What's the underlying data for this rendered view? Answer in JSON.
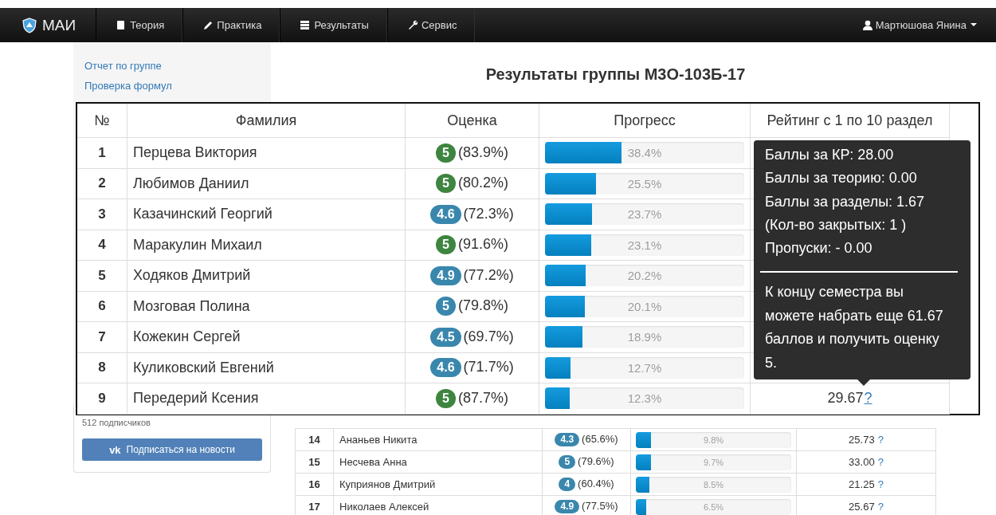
{
  "navbar": {
    "brand": "МАИ",
    "items": [
      {
        "label": "Теория",
        "kind": "book"
      },
      {
        "label": "Практика",
        "kind": "pencil"
      },
      {
        "label": "Результаты",
        "kind": "list"
      },
      {
        "label": "Сервис",
        "kind": "wrench"
      }
    ],
    "user": "Мартюшова Янина"
  },
  "sidebar": {
    "links": [
      "Отчет по группе",
      "Проверка формул"
    ],
    "subscribers": "512 подписчиков",
    "subscribe_button": {
      "logo": "vk",
      "label": "Подписаться на новости"
    }
  },
  "page_title": "Результаты группы М3О-103Б-17",
  "table": {
    "rows": [
      {
        "num": "14",
        "name": "Ананьев Никита",
        "grade": "4.3",
        "color": "#3a87ad",
        "percent": "(65.6%)",
        "level": 0.098,
        "progress": "9.8%",
        "rating": "25.73",
        "help": "?"
      },
      {
        "num": "15",
        "name": "Несчева Анна",
        "grade": "5",
        "color": "#3a87ad",
        "percent": "(79.6%)",
        "level": 0.097,
        "progress": "9.7%",
        "rating": "33.00",
        "help": "?"
      },
      {
        "num": "16",
        "name": "Куприянов Дмитрий",
        "grade": "4",
        "color": "#3a87ad",
        "percent": "(60.4%)",
        "level": 0.085,
        "progress": "8.5%",
        "rating": "21.25",
        "help": "?"
      },
      {
        "num": "17",
        "name": "Николаев Алексей",
        "grade": "4.9",
        "color": "#3a87ad",
        "percent": "(77.5%)",
        "level": 0.065,
        "progress": "6.5%",
        "rating": "25.67",
        "help": "?"
      }
    ]
  },
  "zoom_table": {
    "columns": [
      "№",
      "Фамилия",
      "Оценка",
      "Прогресс",
      "Рейтинг с 1 по 10 раздел"
    ],
    "rows": [
      {
        "num": "1",
        "name": "Перцева Виктория",
        "grade": "5",
        "color": "#3e8540",
        "percent": "(83.9%)",
        "level": 0.384,
        "progress": "38.4%"
      },
      {
        "num": "2",
        "name": "Любимов Даниил",
        "grade": "5",
        "color": "#3e8540",
        "percent": "(80.2%)",
        "level": 0.255,
        "progress": "25.5%"
      },
      {
        "num": "3",
        "name": "Казачинский Георгий",
        "grade": "4.6",
        "color": "#3a87ad",
        "percent": "(72.3%)",
        "level": 0.237,
        "progress": "23.7%"
      },
      {
        "num": "4",
        "name": "Маракулин Михаил",
        "grade": "5",
        "color": "#3e8540",
        "percent": "(91.6%)",
        "level": 0.231,
        "progress": "23.1%"
      },
      {
        "num": "5",
        "name": "Ходяков Дмитрий",
        "grade": "4.9",
        "color": "#3a87ad",
        "percent": "(77.2%)",
        "level": 0.202,
        "progress": "20.2%"
      },
      {
        "num": "6",
        "name": "Мозговая Полина",
        "grade": "5",
        "color": "#3a87ad",
        "percent": "(79.8%)",
        "level": 0.201,
        "progress": "20.1%"
      },
      {
        "num": "7",
        "name": "Кожекин Сергей",
        "grade": "4.5",
        "color": "#3a87ad",
        "percent": "(69.7%)",
        "level": 0.189,
        "progress": "18.9%"
      },
      {
        "num": "8",
        "name": "Куликовский Евгений",
        "grade": "4.6",
        "color": "#3a87ad",
        "percent": "(71.7%)",
        "level": 0.127,
        "progress": "12.7%"
      },
      {
        "num": "9",
        "name": "Передерий Ксения",
        "grade": "5",
        "color": "#3e8540",
        "percent": "(87.7%)",
        "level": 0.123,
        "progress": "12.3%",
        "rating": "29.67",
        "help": "?",
        "hovered": true
      }
    ]
  },
  "tooltip": {
    "lines": [
      "Баллы за КР: 28.00",
      "Баллы за теорию: 0.00",
      "Баллы за разделы: 1.67",
      "(Кол-во закрытых: 1 )",
      "Пропуски: - 0.00"
    ],
    "note": "К концу семестра вы можете набрать еще 61.67 баллов и получить оценку 5."
  }
}
